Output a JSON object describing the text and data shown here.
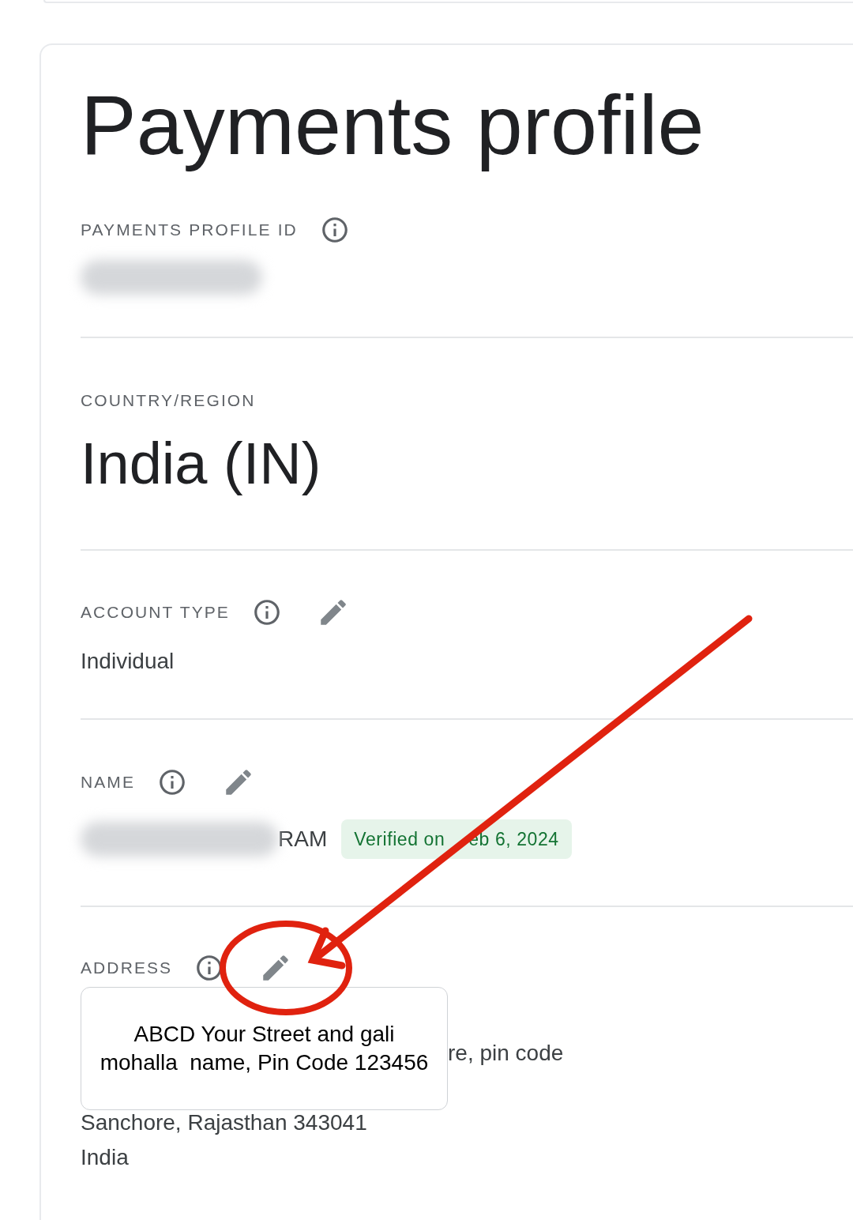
{
  "title": "Payments profile",
  "sections": [
    {
      "kind": "redacted",
      "label": "PAYMENTS PROFILE ID",
      "info": true,
      "edit": false
    },
    {
      "kind": "large",
      "label": "COUNTRY/REGION",
      "info": false,
      "edit": false,
      "value": "India (IN)"
    },
    {
      "kind": "plain",
      "label": "ACCOUNT TYPE",
      "info": true,
      "edit": true,
      "value": "Individual"
    },
    {
      "kind": "name",
      "label": "NAME",
      "info": true,
      "edit": true,
      "value": "RAM",
      "badge": {
        "before_arrow": "Verified on",
        "after_arrow": "eb 6, 2024"
      }
    },
    {
      "kind": "address",
      "label": "ADDRESS",
      "info": true,
      "edit": true,
      "partial_line": "re, pin code",
      "lines": [
        "Sanchore, Rajasthan 343041",
        "India"
      ]
    }
  ],
  "callout": {
    "text": "ABCD Your Street and gali\nmohalla  name, Pin Code 123456"
  }
}
